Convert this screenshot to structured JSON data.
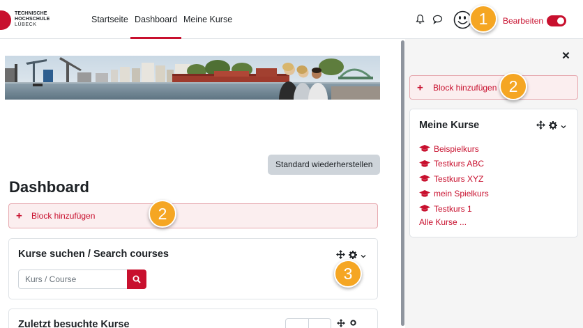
{
  "logo": {
    "line1": "TECHNISCHE",
    "line2": "HOCHSCHULE",
    "line3": "LÜBECK"
  },
  "nav": {
    "items": [
      {
        "label": "Startseite"
      },
      {
        "label": "Dashboard"
      },
      {
        "label": "Meine Kurse"
      }
    ],
    "active": "Dashboard",
    "edit_label": "Bearbeiten",
    "edit_mode": true
  },
  "main": {
    "reset_button": "Standard wiederherstellen",
    "title": "Dashboard",
    "add_block": "Block hinzufügen",
    "search_card": {
      "title": "Kurse suchen / Search courses",
      "placeholder": "Kurs / Course"
    },
    "recent_card": {
      "title": "Zuletzt besuchte Kurse"
    }
  },
  "drawer": {
    "add_block": "Block hinzufügen",
    "my_courses": {
      "title": "Meine Kurse",
      "courses": [
        "Beispielkurs",
        "Testkurs ABC",
        "Testkurs XYZ",
        "mein Spielkurs",
        "Testkurs 1"
      ],
      "all_courses": "Alle Kurse ..."
    }
  },
  "callouts": [
    "1",
    "2",
    "2",
    "3"
  ],
  "colors": {
    "brand": "#c8102e",
    "callout": "#f5a623",
    "drawer_bg": "#f5f5f5"
  }
}
